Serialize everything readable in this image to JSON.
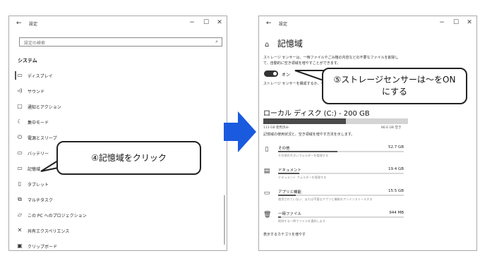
{
  "left_window": {
    "title": "設定",
    "search_placeholder": "設定の検索",
    "section": "システム",
    "nav": [
      {
        "label": "ディスプレイ",
        "icon": "monitor-icon"
      },
      {
        "label": "サウンド",
        "icon": "speaker-icon"
      },
      {
        "label": "通知とアクション",
        "icon": "notification-icon"
      },
      {
        "label": "集中モード",
        "icon": "moon-icon"
      },
      {
        "label": "電源とスリープ",
        "icon": "power-icon"
      },
      {
        "label": "バッテリー",
        "icon": "battery-icon"
      },
      {
        "label": "記憶域",
        "icon": "storage-icon"
      },
      {
        "label": "タブレット",
        "icon": "tablet-icon"
      },
      {
        "label": "マルチタスク",
        "icon": "multitask-icon"
      },
      {
        "label": "この PC へのプロジェクション",
        "icon": "projection-icon"
      },
      {
        "label": "共有エクスペリエンス",
        "icon": "share-icon"
      },
      {
        "label": "クリップボード",
        "icon": "clipboard-icon"
      }
    ]
  },
  "callout1": "④記憶域をクリック",
  "callout2_line1": "⑤ストレージセンサーは～をON",
  "callout2_line2": "にする",
  "right_window": {
    "title": "設定",
    "heading": "記憶域",
    "desc_line1": "ストレージ センサーは、一時ファイルやごみ箱の内容などの不要なファイルを削除し",
    "desc_line2": "て、自動的に空き領域を増やすことができます。",
    "toggle_label": "オン",
    "config_link": "ストレージ センサーを構成するか、今すぐ実行する",
    "disk_title": "ローカル ディスク (C:) - 200 GB",
    "disk_used_fraction": 0.57,
    "used_label": "113 GB 使用済み",
    "free_label": "86.6 GB 空き",
    "disk_info": "記憶域の使用状況と、空き領域を増やす方法を示します。",
    "categories": [
      {
        "name": "その他",
        "size": "52.7 GB",
        "desc": "その他の大きいフォルダーを管理する",
        "fraction": 0.47,
        "icon": "other-icon"
      },
      {
        "name": "ドキュメント",
        "size": "19.4 GB",
        "desc": "ドキュメント フォルダーを管理する",
        "fraction": 0.17,
        "icon": "document-icon"
      },
      {
        "name": "アプリと機能",
        "size": "15.5 GB",
        "desc": "使用されていない、または不要なアプリと機能をアンインストールする",
        "fraction": 0.14,
        "icon": "apps-icon"
      },
      {
        "name": "一時ファイル",
        "size": "944 MB",
        "desc": "削除する一時ファイルを選択します",
        "fraction": 0.02,
        "icon": "trash-icon"
      }
    ],
    "more_link": "表示するカテゴリを増やす"
  }
}
